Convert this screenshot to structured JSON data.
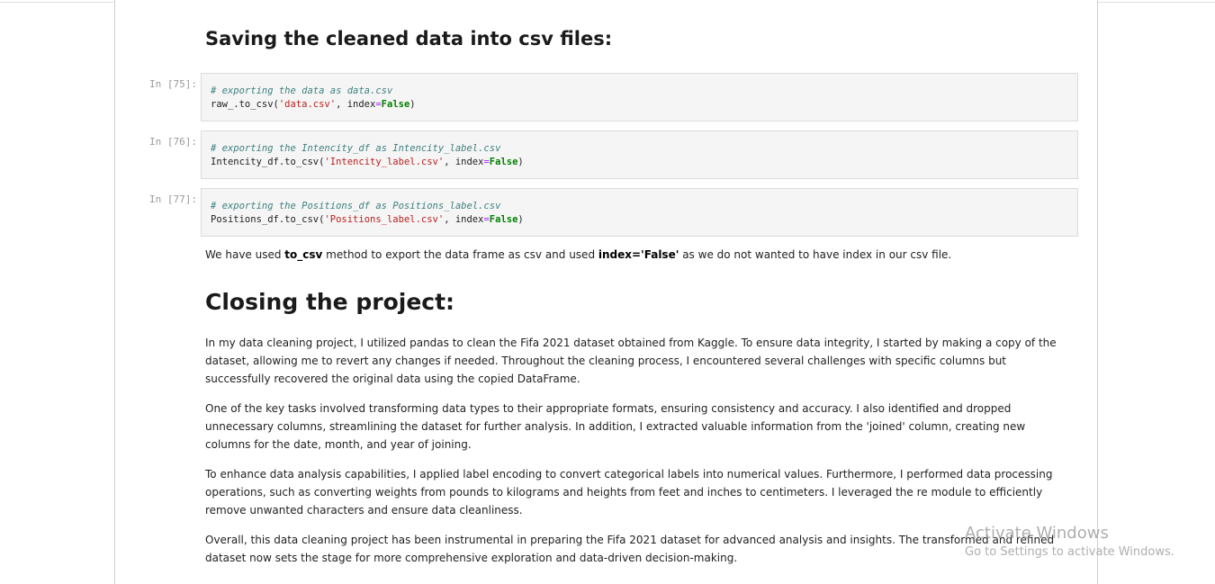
{
  "sections": {
    "saving_heading": "Saving the cleaned data into csv files:",
    "closing_heading": "Closing the project:"
  },
  "cells": [
    {
      "prompt": "In [75]:",
      "comment": "# exporting the data as data.csv",
      "code_prefix": "raw_.to_csv(",
      "code_string": "'data.csv'",
      "code_mid": ", index",
      "code_eq": "=",
      "code_kw": "False",
      "code_suffix": ")"
    },
    {
      "prompt": "In [76]:",
      "comment": "# exporting the Intencity_df as Intencity_label.csv",
      "code_prefix": "Intencity_df.to_csv(",
      "code_string": "'Intencity_label.csv'",
      "code_mid": ", index",
      "code_eq": "=",
      "code_kw": "False",
      "code_suffix": ")"
    },
    {
      "prompt": "In [77]:",
      "comment": "# exporting the Positions_df as Positions_label.csv",
      "code_prefix": "Positions_df.to_csv(",
      "code_string": "'Positions_label.csv'",
      "code_mid": ", index",
      "code_eq": "=",
      "code_kw": "False",
      "code_suffix": ")"
    }
  ],
  "note": {
    "t1": "We have used ",
    "b1": "to_csv",
    "t2": " method to export the data frame as csv and used ",
    "b2": "index='False'",
    "t3": " as we do not wanted to have index in our csv file."
  },
  "closing": {
    "p1": "In my data cleaning project, I utilized pandas to clean the Fifa 2021 dataset obtained from Kaggle. To ensure data integrity, I started by making a copy of the dataset, allowing me to revert any changes if needed. Throughout the cleaning process, I encountered several challenges with specific columns but successfully recovered the original data using the copied DataFrame.",
    "p2": "One of the key tasks involved transforming data types to their appropriate formats, ensuring consistency and accuracy. I also identified and dropped unnecessary columns, streamlining the dataset for further analysis. In addition, I extracted valuable information from the 'joined' column, creating new columns for the date, month, and year of joining.",
    "p3": "To enhance data analysis capabilities, I applied label encoding to convert categorical labels into numerical values. Furthermore, I performed data processing operations, such as converting weights from pounds to kilograms and heights from feet and inches to centimeters. I leveraged the re module to efficiently remove unwanted characters and ensure data cleanliness.",
    "p4": "Overall, this data cleaning project has been instrumental in preparing the Fifa 2021 dataset for advanced analysis and insights. The transformed and refined dataset now sets the stage for more comprehensive exploration and data-driven decision-making."
  },
  "watermark": {
    "title": "Activate Windows",
    "subtitle": "Go to Settings to activate Windows."
  }
}
